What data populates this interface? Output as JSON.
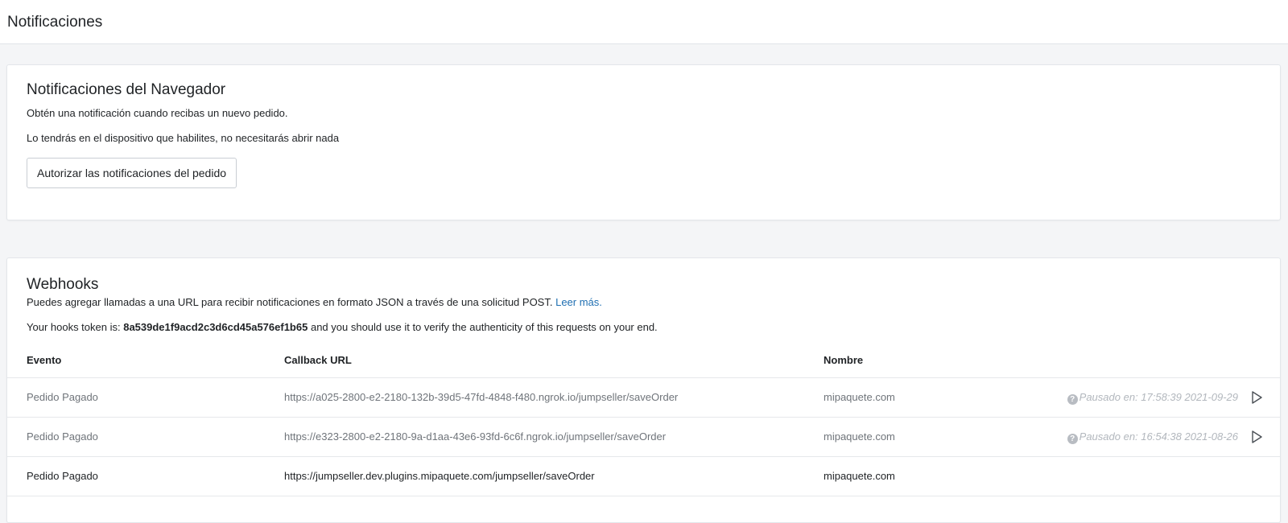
{
  "header": {
    "title": "Notificaciones"
  },
  "browser_notifications": {
    "title": "Notificaciones del Navegador",
    "line1": "Obtén una notificación cuando recibas un nuevo pedido.",
    "line2": "Lo tendrás en el dispositivo que habilites, no necesitarás abrir nada",
    "authorize_button": "Autorizar las notificaciones del pedido"
  },
  "webhooks": {
    "title": "Webhooks",
    "description": "Puedes agregar llamadas a una URL para recibir notificaciones en formato JSON a través de una solicitud POST.",
    "read_more": "Leer más.",
    "token_prefix": "Your hooks token is:",
    "token": "8a539de1f9acd2c3d6cd45a576ef1b65",
    "token_suffix": "and you should use it to verify the authenticity of this requests on your end.",
    "columns": {
      "event": "Evento",
      "callback_url": "Callback URL",
      "name": "Nombre"
    },
    "rows": [
      {
        "event": "Pedido Pagado",
        "url": "https://a025-2800-e2-2180-132b-39d5-47fd-4848-f480.ngrok.io/jumpseller/saveOrder",
        "name": "mipaquete.com",
        "status": "Pausado en: 17:58:39 2021-09-29",
        "paused": true
      },
      {
        "event": "Pedido Pagado",
        "url": "https://e323-2800-e2-2180-9a-d1aa-43e6-93fd-6c6f.ngrok.io/jumpseller/saveOrder",
        "name": "mipaquete.com",
        "status": "Pausado en: 16:54:38 2021-08-26",
        "paused": true
      },
      {
        "event": "Pedido Pagado",
        "url": "https://jumpseller.dev.plugins.mipaquete.com/jumpseller/saveOrder",
        "name": "mipaquete.com",
        "status": "",
        "paused": false
      }
    ]
  },
  "icons": {
    "help": "question-circle-icon",
    "resume": "play-icon"
  },
  "colors": {
    "link": "#1f6fb2",
    "muted_text": "#6f747a",
    "status_text": "#b2b7bd",
    "background": "#f4f5f7"
  }
}
